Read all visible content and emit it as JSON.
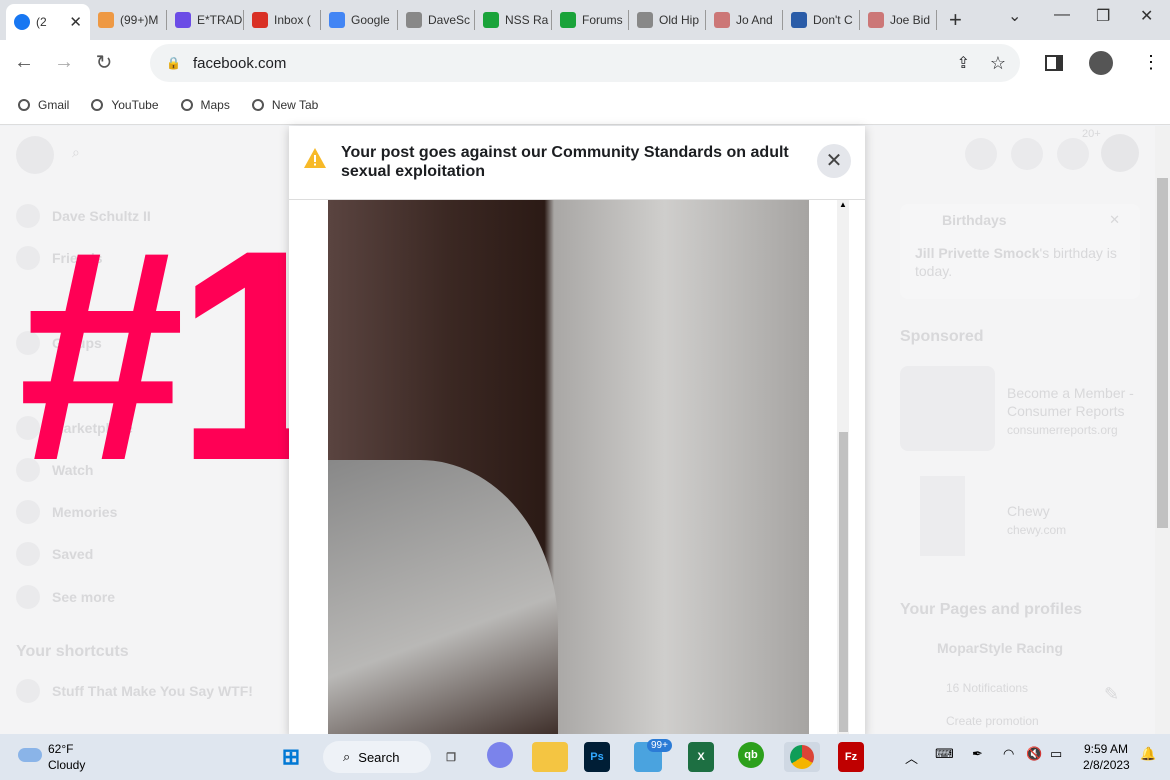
{
  "browser": {
    "tabs": [
      {
        "label": "(2",
        "icon": "facebook-icon",
        "color": "#1877f2",
        "active": true
      },
      {
        "label": "(99+)M",
        "icon": "dots-icon",
        "color": "#e94"
      },
      {
        "label": "E*TRAD",
        "icon": "etrade-icon",
        "color": "#6b4ce6"
      },
      {
        "label": "Inbox (",
        "icon": "gmail-icon",
        "color": "#d93025"
      },
      {
        "label": "Google",
        "icon": "calendar-icon",
        "color": "#4285f4"
      },
      {
        "label": "DaveSc",
        "icon": "ghost-icon",
        "color": "#888"
      },
      {
        "label": "NSS Ra",
        "icon": "thumbs-up-icon",
        "color": "#1aa33a"
      },
      {
        "label": "Forums",
        "icon": "thumbs-up-icon",
        "color": "#1aa33a"
      },
      {
        "label": "Old Hip",
        "icon": "ghost-icon",
        "color": "#888"
      },
      {
        "label": "Jo And",
        "icon": "face-icon",
        "color": "#c77"
      },
      {
        "label": "Don't C",
        "icon": "flag-icon",
        "color": "#2a5ca8"
      },
      {
        "label": "Joe Bid",
        "icon": "face-icon",
        "color": "#c77"
      }
    ],
    "url": "facebook.com",
    "bookmarks": [
      "Gmail",
      "YouTube",
      "Maps",
      "New Tab"
    ]
  },
  "facebook": {
    "sidebar": [
      "Dave Schultz II",
      "Friends",
      "Groups",
      "Marketplace",
      "Watch",
      "Memories",
      "Saved",
      "See more"
    ],
    "shortcuts_title": "Your shortcuts",
    "shortcuts": [
      "Stuff That Make You Say WTF!"
    ],
    "notif_badge": "20+",
    "birthdays": {
      "title": "Birthdays",
      "name": "Jill Privette Smock",
      "text": "'s birthday is today."
    },
    "sponsored_title": "Sponsored",
    "ads": [
      {
        "title": "Become a Member - Consumer Reports",
        "domain": "consumerreports.org"
      },
      {
        "title": "Chewy",
        "domain": "chewy.com"
      }
    ],
    "pages_title": "Your Pages and profiles",
    "page_name": "MoparStyle Racing",
    "notifications": "16 Notifications",
    "promotion": "Create promotion"
  },
  "overlay_text": "#1",
  "modal": {
    "title": "Your post goes against our Community Standards on adult sexual exploitation",
    "warning_color": "#f7b928"
  },
  "taskbar": {
    "temp": "62°F",
    "weather": "Cloudy",
    "search": "Search",
    "badge": "99+",
    "time": "9:59 AM",
    "date": "2/8/2023"
  }
}
